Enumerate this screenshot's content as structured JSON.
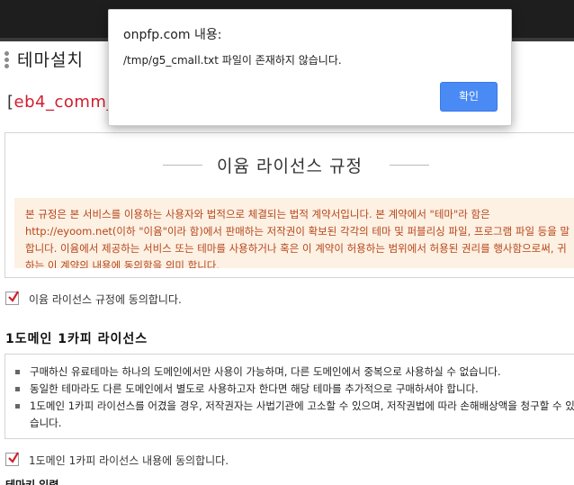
{
  "page": {
    "title": "테마설치",
    "theme_name": "eb4_comm_",
    "bracket_open": "["
  },
  "license": {
    "title": "이윰 라이선스 규정",
    "text": "본 규정은 본 서비스를 이용하는 사용자와 법적으로 체결되는 법적 계약서입니다. 본 계약에서 \"테마\"라 함은 http://eyoom.net(이하 \"이윰\"이라 함)에서 판매하는 저작권이 확보된 각각의 테마 및 퍼블리싱 파일, 프로그램 파일 등을 말합니다. 이윰에서 제공하는 서비스 또는 테마를 사용하거나 혹은 이 계약이 허용하는 범위에서 허용된 권리를 행사함으로써, 귀하는 이 계약의 내용에 동의함을 의미 합니다.",
    "agree_label": "이윰 라이선스 규정에 동의합니다."
  },
  "domain_license": {
    "title": "1도메인 1카피 라이선스",
    "items": [
      "구매하신 유료테마는 하나의 도메인에서만 사용이 가능하며, 다른 도메인에서 중복으로 사용하실 수 없습니다.",
      "동일한 테마라도 다른 도메인에서 별도로 사용하고자 한다면 해당 테마를 추가적으로 구매하셔야 합니다.",
      "1도메인 1카피 라이선스를 어겼을 경우, 저작권자는 사법기관에 고소할 수 있으며, 저작권법에 따라 손해배상액을 청구할 수 있습니다."
    ],
    "agree_label": "1도메인 1카피 라이선스 내용에 동의합니다."
  },
  "bottom": {
    "title": "테마키 입력"
  },
  "dialog": {
    "origin": "onpfp.com 내용:",
    "message": "/tmp/g5_cmall.txt 파일이 존재하지 않습니다.",
    "ok_label": "확인"
  },
  "colors": {
    "accent": "#4a8af4",
    "theme_name": "#d21d2e",
    "license_text": "#b5451b",
    "license_bg": "#fdf1e3",
    "check": "#d11f2d"
  },
  "icons": {
    "menu": "vertical-dots-icon",
    "check": "check-icon"
  }
}
